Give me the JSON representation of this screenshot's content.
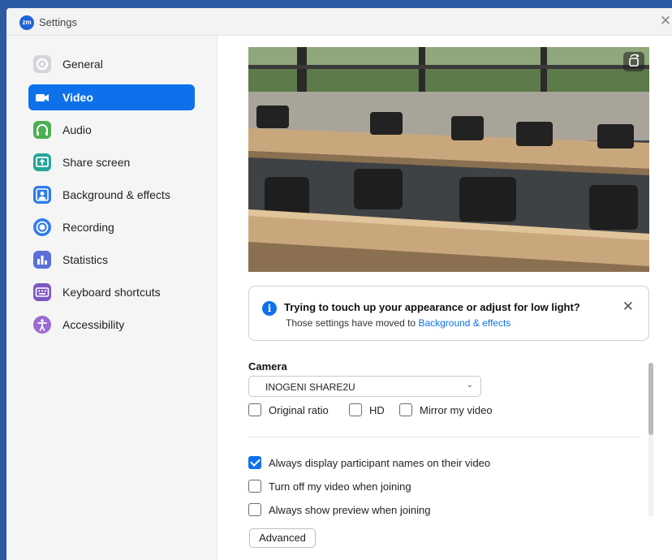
{
  "window": {
    "title": "Settings",
    "logo_text": "zm",
    "close_glyph": "✕"
  },
  "sidebar": {
    "items": [
      {
        "label": "General",
        "icon": "gear-icon",
        "color": "#d9d9dc",
        "active": false
      },
      {
        "label": "Video",
        "icon": "video-camera-icon",
        "color": "#0e71eb",
        "active": true
      },
      {
        "label": "Audio",
        "icon": "headphones-icon",
        "color": "#4caf50",
        "active": false
      },
      {
        "label": "Share screen",
        "icon": "share-screen-icon",
        "color": "#26a69a",
        "active": false
      },
      {
        "label": "Background & effects",
        "icon": "person-background-icon",
        "color": "#2f7bea",
        "active": false
      },
      {
        "label": "Recording",
        "icon": "record-icon",
        "color": "#2f7bea",
        "active": false
      },
      {
        "label": "Statistics",
        "icon": "bar-chart-icon",
        "color": "#5b6fd6",
        "active": false
      },
      {
        "label": "Keyboard shortcuts",
        "icon": "keyboard-icon",
        "color": "#7e57c2",
        "active": false
      },
      {
        "label": "Accessibility",
        "icon": "accessibility-icon",
        "color": "#9c6ad0",
        "active": false
      }
    ]
  },
  "notice": {
    "title": "Trying to touch up your appearance or adjust for low light?",
    "text": "Those settings have moved to",
    "link": "Background & effects",
    "icon": "info-icon",
    "close_glyph": "✕"
  },
  "camera": {
    "label": "Camera",
    "selected": "INOGENI SHARE2U",
    "chevron": "⌄",
    "options": [
      {
        "label": "Original ratio",
        "checked": false
      },
      {
        "label": "HD",
        "checked": false
      },
      {
        "label": "Mirror my video",
        "checked": false
      }
    ]
  },
  "settings": [
    {
      "label": "Always display participant names on their video",
      "checked": true
    },
    {
      "label": "Turn off my video when joining",
      "checked": false
    },
    {
      "label": "Always show preview when joining",
      "checked": false
    }
  ],
  "advanced_button": "Advanced",
  "colors": {
    "accent": "#0e71eb",
    "window_frame": "#2c5aa5"
  }
}
